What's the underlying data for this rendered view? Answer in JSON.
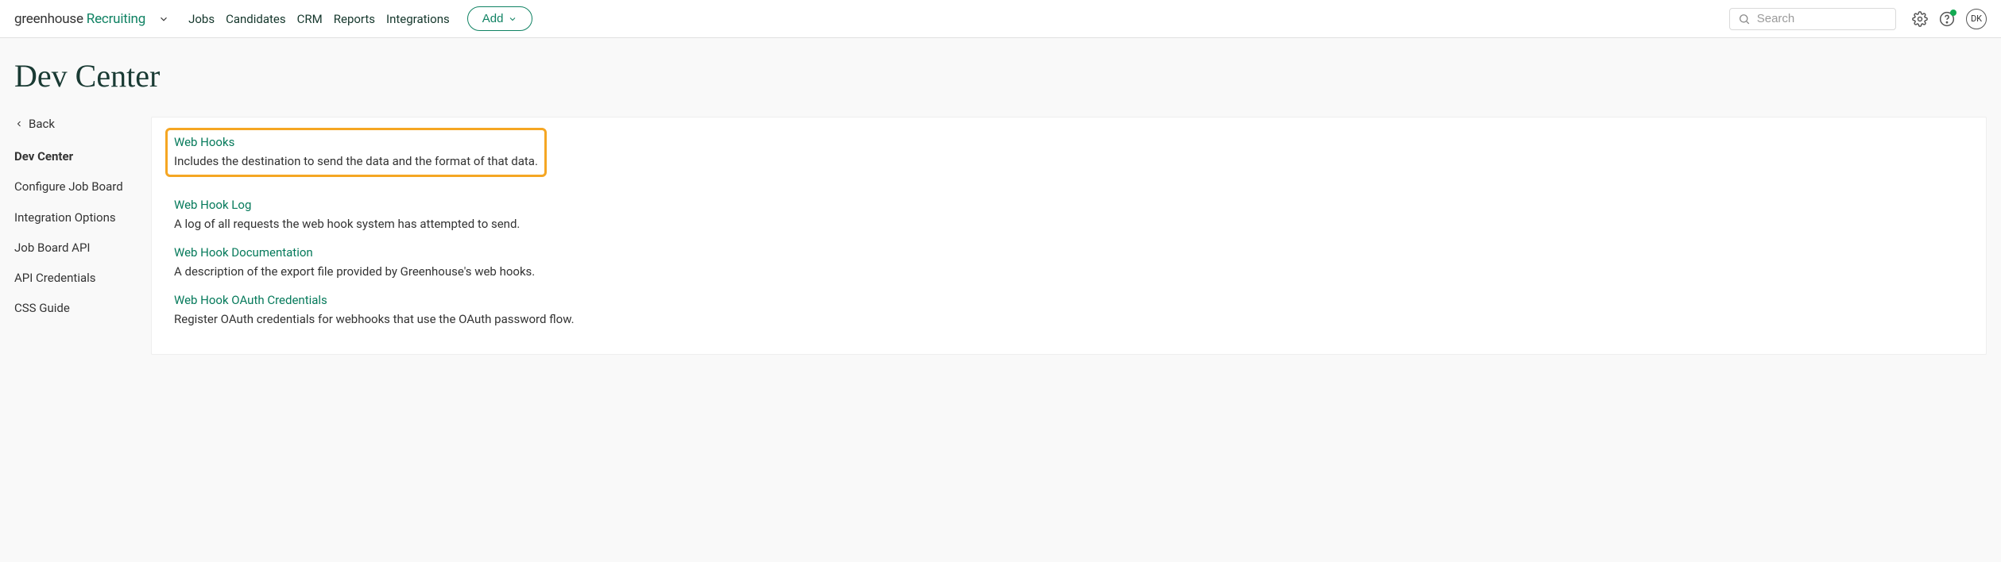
{
  "header": {
    "logo_main": "greenhouse",
    "logo_sub": "Recruiting",
    "nav": [
      "Jobs",
      "Candidates",
      "CRM",
      "Reports",
      "Integrations"
    ],
    "add_label": "Add",
    "search_placeholder": "Search",
    "avatar_initials": "DK"
  },
  "page": {
    "title": "Dev Center"
  },
  "sidebar": {
    "back_label": "Back",
    "items": [
      "Dev Center",
      "Configure Job Board",
      "Integration Options",
      "Job Board API",
      "API Credentials",
      "CSS Guide"
    ],
    "active_index": 0
  },
  "entries": [
    {
      "title": "Web Hooks",
      "desc": "Includes the destination to send the data and the format of that data.",
      "highlighted": true
    },
    {
      "title": "Web Hook Log",
      "desc": "A log of all requests the web hook system has attempted to send."
    },
    {
      "title": "Web Hook Documentation",
      "desc": "A description of the export file provided by Greenhouse's web hooks."
    },
    {
      "title": "Web Hook OAuth Credentials",
      "desc": "Register OAuth credentials for webhooks that use the OAuth password flow."
    }
  ]
}
